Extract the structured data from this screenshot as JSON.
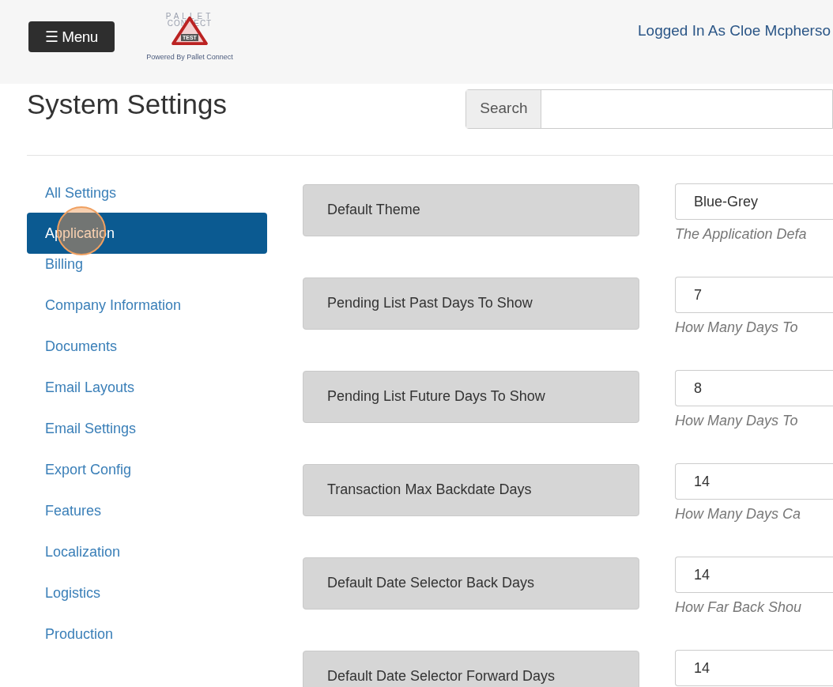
{
  "header": {
    "menu_button": "☰ Menu",
    "logo": {
      "top_line": "PALLET",
      "bottom_line": "CONNECT",
      "badge": "TEST",
      "tagline": "Powered By Pallet Connect"
    },
    "user": "Logged In As Cloe Mcpherso"
  },
  "page_title": "System Settings",
  "search": {
    "label": "Search"
  },
  "sidebar": {
    "items": [
      {
        "label": "All Settings",
        "selected": false
      },
      {
        "label": "Application",
        "selected": true
      },
      {
        "label": "Billing",
        "selected": false
      },
      {
        "label": "Company Information",
        "selected": false
      },
      {
        "label": "Documents",
        "selected": false
      },
      {
        "label": "Email Layouts",
        "selected": false
      },
      {
        "label": "Email Settings",
        "selected": false
      },
      {
        "label": "Export Config",
        "selected": false
      },
      {
        "label": "Features",
        "selected": false
      },
      {
        "label": "Localization",
        "selected": false
      },
      {
        "label": "Logistics",
        "selected": false
      },
      {
        "label": "Production",
        "selected": false
      }
    ]
  },
  "settings": [
    {
      "label": "Default Theme",
      "value": "Blue-Grey",
      "help": "The Application Defa"
    },
    {
      "label": "Pending List Past Days To Show",
      "value": "7",
      "help": "How Many Days To"
    },
    {
      "label": "Pending List Future Days To Show",
      "value": "8",
      "help": "How Many Days To"
    },
    {
      "label": "Transaction Max Backdate Days",
      "value": "14",
      "help": "How Many Days Ca"
    },
    {
      "label": "Default Date Selector Back Days",
      "value": "14",
      "help": "How Far Back Shou"
    },
    {
      "label": "Default Date Selector Forward Days",
      "value": "14"
    }
  ]
}
